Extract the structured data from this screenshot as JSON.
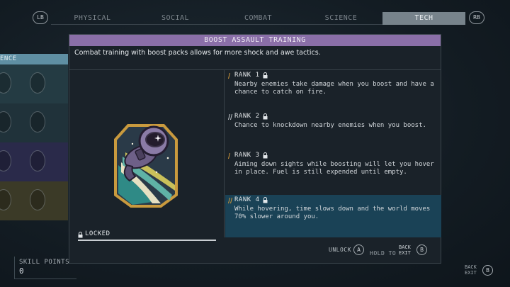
{
  "top_tabs": {
    "left_bumper": "LB",
    "right_bumper": "RB",
    "items": [
      {
        "label": "PHYSICAL",
        "active": false
      },
      {
        "label": "SOCIAL",
        "active": false
      },
      {
        "label": "COMBAT",
        "active": false
      },
      {
        "label": "SCIENCE",
        "active": false
      },
      {
        "label": "TECH",
        "active": true
      }
    ]
  },
  "background_tree": {
    "header": "ENCE"
  },
  "skill_points": {
    "label": "SKILL POINTS",
    "value": "0"
  },
  "corner_back": {
    "label_line1": "BACK",
    "label_line2": "EXIT",
    "button": "B"
  },
  "modal": {
    "title": "BOOST ASSAULT TRAINING",
    "description": "Combat training with boost packs allows for more shock and awe tactics.",
    "status": "LOCKED",
    "ranks": [
      {
        "title": "RANK 1",
        "description": "Nearby enemies take damage when you boost and have a chance to catch on fire."
      },
      {
        "title": "RANK 2",
        "description": "Chance to knockdown nearby enemies when you boost."
      },
      {
        "title": "RANK 3",
        "description": "Aiming down sights while boosting will let you hover in place. Fuel is still expended until empty."
      },
      {
        "title": "RANK 4",
        "description": "While hovering, time slows down and the world moves 70% slower around you."
      }
    ],
    "footer": {
      "unlock_label": "UNLOCK",
      "unlock_button": "A",
      "hold_to": "HOLD TO",
      "back_line1": "BACK",
      "back_line2": "EXIT",
      "back_button": "B"
    }
  },
  "colors": {
    "title_bar": "#8a6fa8",
    "active_tab": "#77838b",
    "selected_rank": "#1a4256",
    "rank_bars_tier1": "#d39a3a",
    "rank_bars_tier2": "#c9ced2"
  }
}
